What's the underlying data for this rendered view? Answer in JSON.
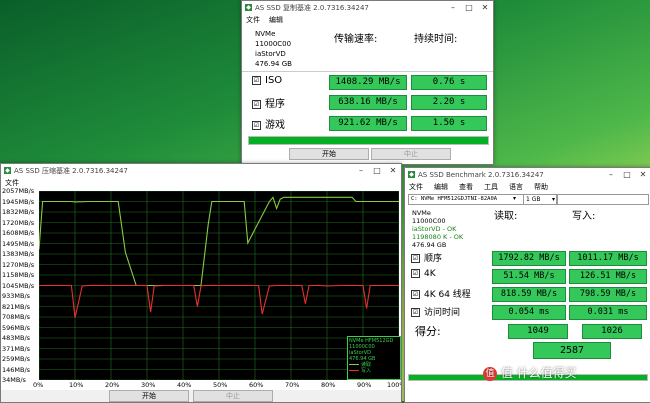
{
  "copy_window": {
    "title": "AS SSD 复制基准 2.0.7316.34247",
    "menu": [
      "文件",
      "编辑"
    ],
    "drive": [
      "NVMe",
      "11000C00",
      "iaStorVD",
      "476.94 GB"
    ],
    "col_speed": "传输速率:",
    "col_time": "持续时间:",
    "rows": [
      {
        "label": "ISO",
        "speed": "1408.29 MB/s",
        "time": "0.76 s"
      },
      {
        "label": "程序",
        "speed": "638.16 MB/s",
        "time": "2.20 s"
      },
      {
        "label": "游戏",
        "speed": "921.62 MB/s",
        "time": "1.50 s"
      }
    ],
    "start": "开始",
    "stop": "中止",
    "progress": 1.0
  },
  "compress_window": {
    "title": "AS SSD 压缩基准 2.0.7316.34247",
    "menu": [
      "文件"
    ],
    "legend_drive": [
      "NVMe HFM512GD",
      "11000C00",
      "iaStorVD",
      "476.94 GB"
    ],
    "legend_read": "读取",
    "legend_write": "写入",
    "start": "开始",
    "stop": "中止"
  },
  "chart_data": {
    "type": "line",
    "y_ticks": [
      "34MB/s",
      "146MB/s",
      "259MB/s",
      "371MB/s",
      "483MB/s",
      "596MB/s",
      "708MB/s",
      "821MB/s",
      "933MB/s",
      "1045MB/s",
      "1158MB/s",
      "1270MB/s",
      "1383MB/s",
      "1495MB/s",
      "1608MB/s",
      "1720MB/s",
      "1832MB/s",
      "1945MB/s",
      "2057MB/s"
    ],
    "x_ticks": [
      "0%",
      "10%",
      "20%",
      "30%",
      "40%",
      "50%",
      "60%",
      "70%",
      "80%",
      "90%",
      "100%"
    ],
    "ylim": [
      34,
      2057
    ],
    "xlim": [
      0,
      100
    ],
    "grid": true,
    "series": [
      {
        "name": "读取",
        "color": "#88cc44",
        "x": [
          0,
          1,
          2,
          9,
          10,
          14,
          18,
          22,
          24,
          27,
          28,
          42,
          45,
          47,
          48,
          50,
          53,
          57,
          58,
          64,
          65,
          66,
          67,
          68,
          72,
          75,
          77,
          80,
          83,
          87,
          88,
          100
        ],
        "y": [
          1430,
          1945,
          1945,
          1945,
          1940,
          1945,
          1945,
          1945,
          1400,
          1045,
          1045,
          1045,
          1045,
          1700,
          1945,
          1945,
          1945,
          1945,
          1500,
          1945,
          1990,
          1870,
          1970,
          1990,
          1990,
          1990,
          1990,
          1990,
          1990,
          1990,
          1945,
          1945
        ]
      },
      {
        "name": "写入",
        "color": "#e83030",
        "x": [
          0,
          2,
          9,
          10,
          12,
          14,
          16,
          28,
          30,
          31,
          32,
          35,
          37,
          40,
          43,
          44,
          45,
          46,
          60,
          61,
          62,
          64,
          66,
          73,
          74,
          75,
          78,
          80,
          84,
          86,
          88,
          90,
          91,
          92,
          95,
          100
        ],
        "y": [
          1045,
          1045,
          1045,
          700,
          1040,
          1045,
          1045,
          1045,
          1045,
          760,
          1040,
          1045,
          1045,
          1045,
          1045,
          820,
          1040,
          1045,
          1045,
          1045,
          740,
          1040,
          1045,
          1045,
          850,
          1045,
          1045,
          1040,
          1045,
          1045,
          1045,
          1045,
          800,
          1045,
          1045,
          1045
        ]
      }
    ]
  },
  "bench_window": {
    "title": "AS SSD Benchmark 2.0.7316.34247",
    "menu": [
      "文件",
      "编辑",
      "查看",
      "工具",
      "语言",
      "帮助"
    ],
    "drive_select": "C: NVMe HFM512GDJTNI-82A0A",
    "size_select": "1 GB",
    "drive": [
      "NVMe",
      "11000C00",
      "iaStorVD - OK",
      "1198080 K - OK",
      "476.94 GB"
    ],
    "col_read": "读取:",
    "col_write": "写入:",
    "rows": [
      {
        "label": "顺序",
        "read": "1792.82 MB/s",
        "write": "1011.17 MB/s"
      },
      {
        "label": "4K",
        "read": "51.54 MB/s",
        "write": "126.51 MB/s"
      },
      {
        "label": "4K 64 线程",
        "read": "818.59 MB/s",
        "write": "798.59 MB/s"
      },
      {
        "label": "访问时间",
        "read": "0.054 ms",
        "write": "0.031 ms"
      }
    ],
    "score_label": "得分:",
    "score_read": "1049",
    "score_write": "1026",
    "score_total": "2587",
    "progress": 1.0
  },
  "watermark": "值 什么值得买"
}
